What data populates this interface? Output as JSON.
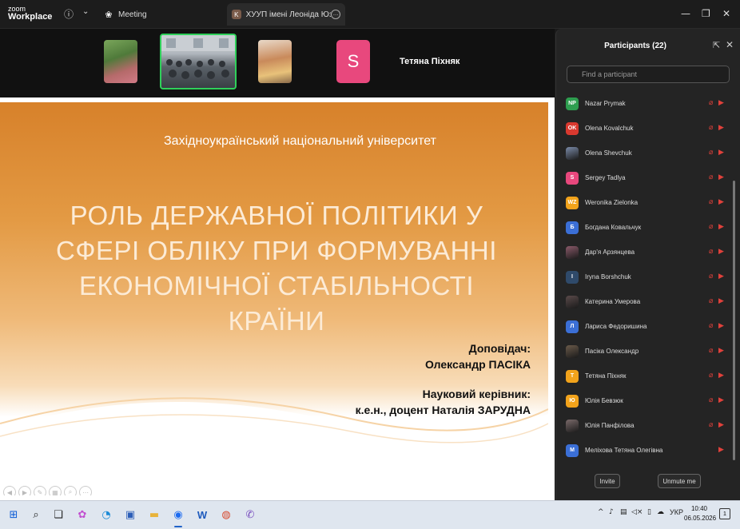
{
  "app": {
    "brand_line1": "zoom",
    "brand_line2": "Workplace"
  },
  "tabs": [
    {
      "label": "Meeting",
      "icon": "paw-icon"
    },
    {
      "label": "ХУУП імені Леоніда Юзькова's s",
      "icon": "K"
    }
  ],
  "video_strip": {
    "active_speaker_initial": "S",
    "active_speaker_name": "Тетяна  Піхняк"
  },
  "slide": {
    "university": "Західноукраїнський національний університет",
    "title": "РОЛЬ ДЕРЖАВНОЇ ПОЛІТИКИ У СФЕРІ ОБЛІКУ ПРИ ФОРМУВАННІ ЕКОНОМІЧНОЇ СТАБІЛЬНОСТІ КРАЇНИ",
    "speaker_label": "Доповідач:",
    "speaker_name": "Олександр ПАСІКА",
    "advisor_label": "Науковий керівник:",
    "advisor_name": "к.е.н., доцент Наталія ЗАРУДНА"
  },
  "participants": {
    "title": "Participants (22)",
    "search_placeholder": "Find a participant",
    "items": [
      {
        "initials": "NP",
        "color": "#2e9e4f",
        "name": "Nazar Prymak",
        "photo": false,
        "cam": true
      },
      {
        "initials": "OK",
        "color": "#d9392f",
        "name": "Olena Kovalchuk",
        "photo": false,
        "cam": true
      },
      {
        "initials": "",
        "color": "#7a8aa8",
        "name": "Olena Shevchuk",
        "photo": true,
        "cam": true
      },
      {
        "initials": "S",
        "color": "#e8487d",
        "name": "Sergey Tadlya",
        "photo": false,
        "cam": true
      },
      {
        "initials": "WZ",
        "color": "#f2a31b",
        "name": "Weronika Zielonka",
        "photo": false,
        "cam": true
      },
      {
        "initials": "Б",
        "color": "#3b6fd6",
        "name": "Богдана Ковальчук",
        "photo": false,
        "cam": true
      },
      {
        "initials": "",
        "color": "#8a5a6a",
        "name": "Дар'я Арзянцева",
        "photo": true,
        "cam": true
      },
      {
        "initials": "I",
        "color": "#2f4a6a",
        "name": "Iryna Borshchuk",
        "photo": false,
        "cam": true
      },
      {
        "initials": "",
        "color": "#5a4a4a",
        "name": "Катерина Умерова",
        "photo": true,
        "cam": true
      },
      {
        "initials": "Л",
        "color": "#3b6fd6",
        "name": "Лариса Федоришина",
        "photo": false,
        "cam": true
      },
      {
        "initials": "",
        "color": "#6a5a4a",
        "name": "Пасіка Олександр",
        "photo": true,
        "cam": true
      },
      {
        "initials": "T",
        "color": "#f2a31b",
        "name": "Тетяна  Піхняк",
        "photo": false,
        "cam": true
      },
      {
        "initials": "Ю",
        "color": "#f2a31b",
        "name": "Юлія Бевзюк",
        "photo": false,
        "cam": true
      },
      {
        "initials": "",
        "color": "#7a6a6a",
        "name": "Юлія Панфілова",
        "photo": true,
        "cam": true
      },
      {
        "initials": "M",
        "color": "#3b6fd6",
        "name": "Меліхова Тетяна Олегівна",
        "photo": false,
        "cam": false
      }
    ],
    "invite_label": "Invite",
    "unmute_label": "Unmute me"
  },
  "taskbar": {
    "language": "УКР",
    "time": "10:40",
    "date": "06.05.2026"
  }
}
